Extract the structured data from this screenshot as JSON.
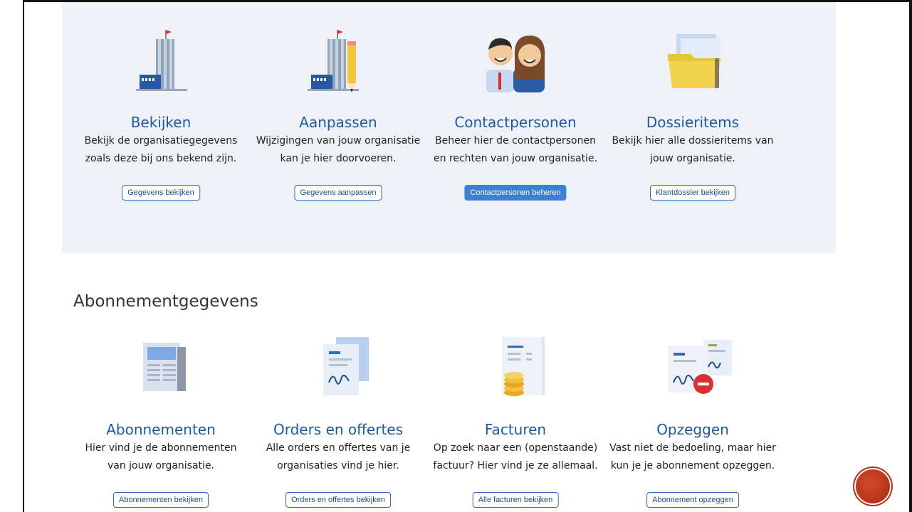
{
  "organisatie": {
    "cards": [
      {
        "title": "Bekijken",
        "desc": "Bekijk de organisatiegegevens\nzoals deze bij ons bekend zijn.",
        "button": "Gegevens bekijken",
        "icon": "building-icon"
      },
      {
        "title": "Aanpassen",
        "desc": "Wijzigingen van jouw organisatie\nkan je hier doorvoeren.",
        "button": "Gegevens aanpassen",
        "icon": "building-pencil-icon"
      },
      {
        "title": "Contactpersonen",
        "desc": "Beheer hier de contactpersonen\nen rechten van jouw organisatie.",
        "button": "Contactpersonen beheren",
        "icon": "contacts-icon"
      },
      {
        "title": "Dossieritems",
        "desc": "Bekijk hier alle dossieritems van\njouw organisatie.",
        "button": "Klantdossier bekijken",
        "icon": "folder-icon"
      }
    ]
  },
  "abonnement": {
    "section_title": "Abonnementgegevens",
    "cards": [
      {
        "title": "Abonnementen",
        "desc": "Hier vind je de abonnementen\nvan jouw organisatie.",
        "button": "Abonnementen bekijken",
        "icon": "newspaper-icon"
      },
      {
        "title": "Orders en offertes",
        "desc": "Alle orders en offertes van je\norganisaties vind je hier.",
        "button": "Orders en offertes bekijken",
        "icon": "signed-document-icon"
      },
      {
        "title": "Facturen",
        "desc": "Op zoek naar een (openstaande)\nfactuur? Hier vind je ze allemaal.",
        "button": "Alle facturen bekijken",
        "icon": "invoice-coins-icon"
      },
      {
        "title": "Opzeggen",
        "desc": "Vast niet de bedoeling, maar hier\nkun je je abonnement opzeggen.",
        "button": "Abonnement opzeggen",
        "icon": "cancel-document-icon"
      }
    ]
  },
  "colors": {
    "accent": "#1b5aa3",
    "panel": "#eef2f7",
    "primary_button": "#3d7fd6"
  }
}
